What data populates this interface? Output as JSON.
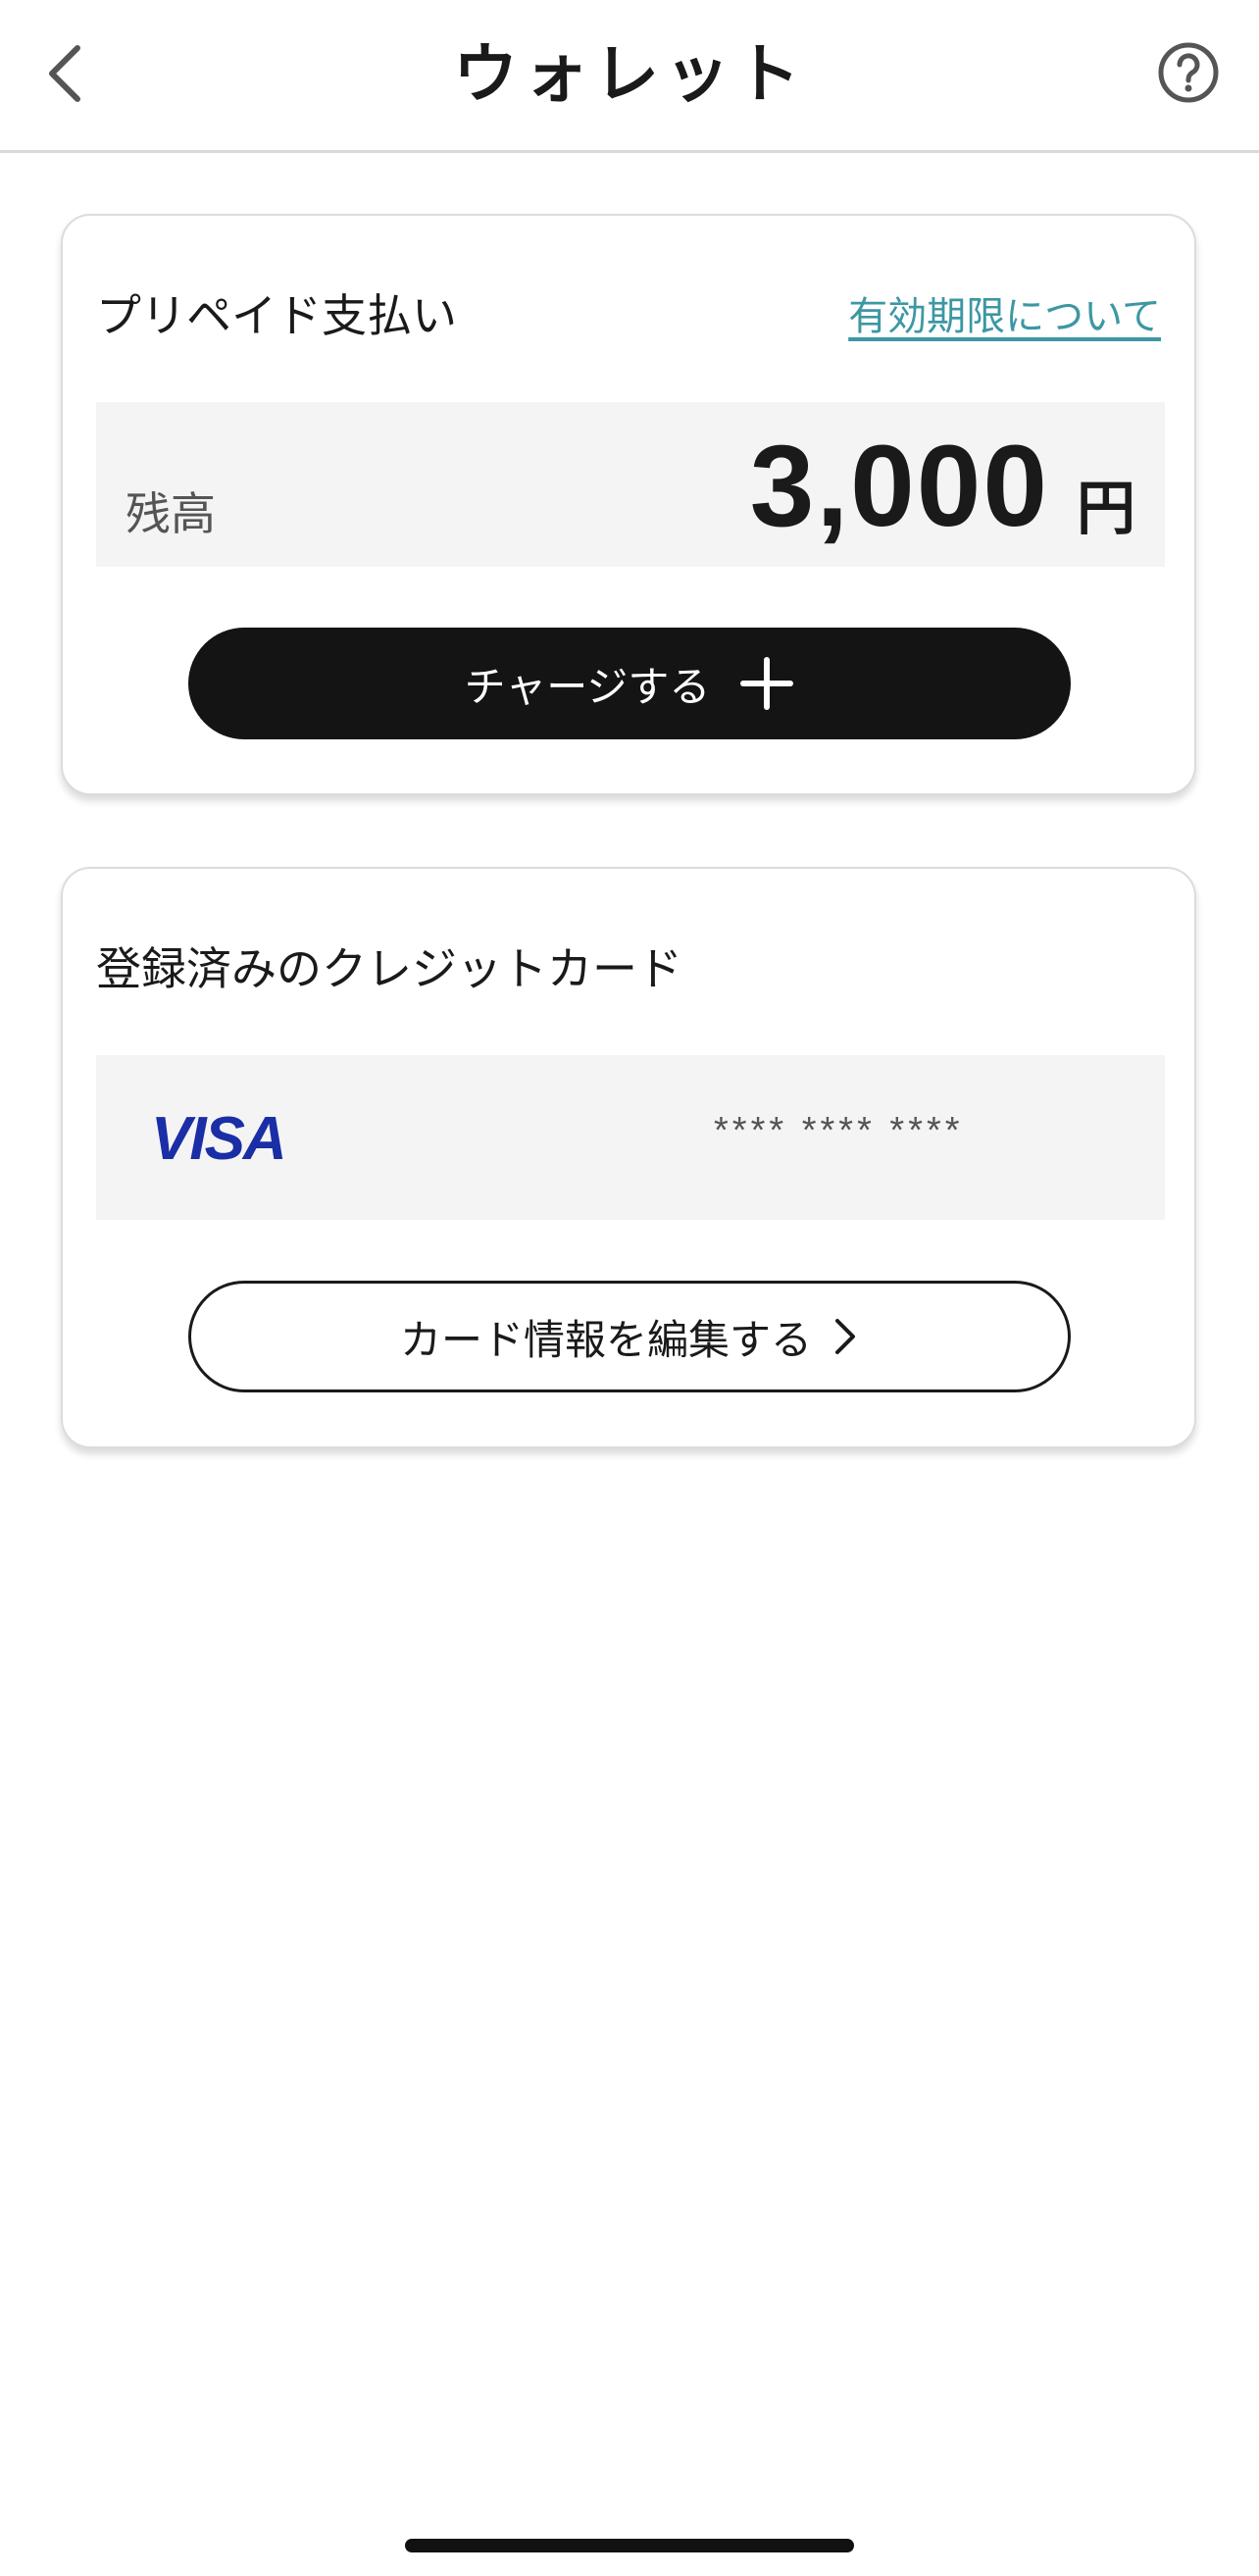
{
  "header": {
    "title": "ウォレット",
    "back_icon": "chevron-left-icon",
    "help_icon": "question-circle-icon"
  },
  "prepaid": {
    "title": "プリペイド支払い",
    "expiry_link": "有効期限について",
    "balance_label": "残高",
    "balance_amount": "3,000",
    "balance_unit": "円",
    "charge_button": "チャージする",
    "charge_icon": "plus-icon"
  },
  "credit": {
    "title": "登録済みのクレジットカード",
    "card_brand": "VISA",
    "card_number": "**** **** ****",
    "edit_button": "カード情報を編集する",
    "edit_icon": "chevron-right-icon"
  },
  "colors": {
    "link": "#3d97a3",
    "button_dark": "#141414",
    "visa_blue": "#1a2ea6"
  }
}
